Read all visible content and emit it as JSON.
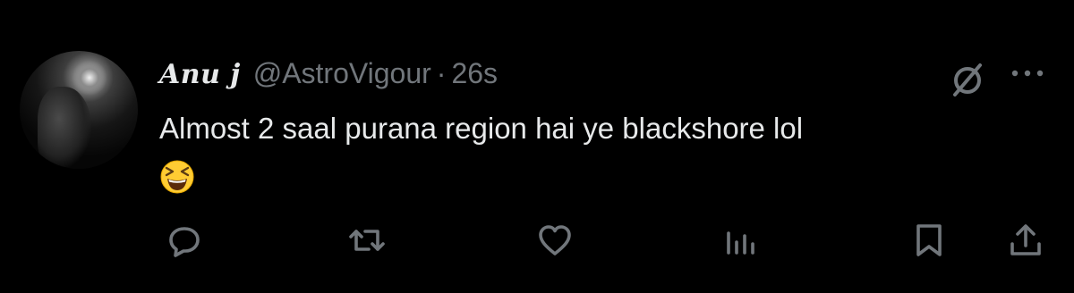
{
  "tweet": {
    "author_name": "Anu j",
    "author_handle": "@AstroVigour",
    "separator": "·",
    "timestamp": "26s",
    "text": "Almost 2 saal purana region hai ye blackshore lol",
    "emoji": "😆"
  },
  "icons": {
    "avatar": "avatar",
    "grok": "grok-icon",
    "more": "more-icon",
    "reply": "reply-icon",
    "retweet": "retweet-icon",
    "like": "like-icon",
    "views": "views-icon",
    "bookmark": "bookmark-icon",
    "share": "share-icon"
  },
  "colors": {
    "background": "#000000",
    "text_primary": "#e7e9ea",
    "text_secondary": "#71767b"
  }
}
